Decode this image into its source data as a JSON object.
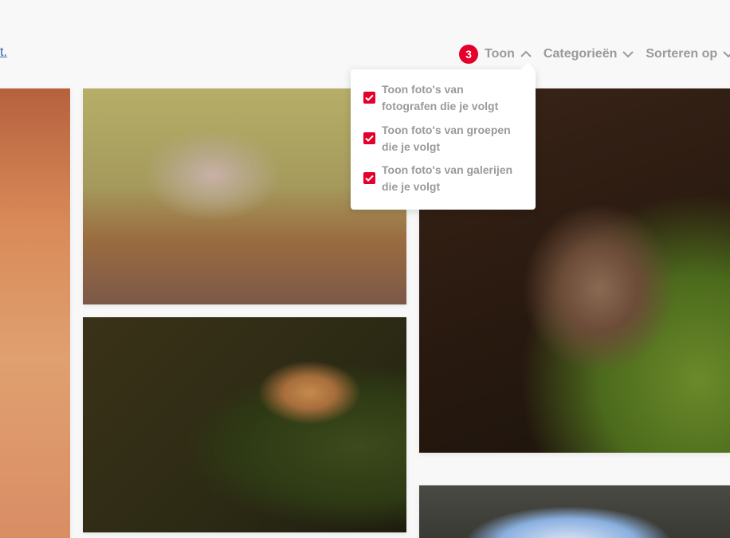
{
  "header": {
    "link_fragment": "t."
  },
  "toolbar": {
    "badge_count": "3",
    "show_label": "Toon",
    "categories_label": "Categorieën",
    "sort_label": "Sorteren op"
  },
  "dropdown": {
    "options": [
      {
        "label": "Toon foto's van fotografen die je volgt",
        "checked": true
      },
      {
        "label": "Toon foto's van groepen die je volgt",
        "checked": true
      },
      {
        "label": "Toon foto's van galerijen die je volgt",
        "checked": true
      }
    ]
  },
  "colors": {
    "accent": "#e4002b",
    "muted_text": "#9a9a9a"
  }
}
